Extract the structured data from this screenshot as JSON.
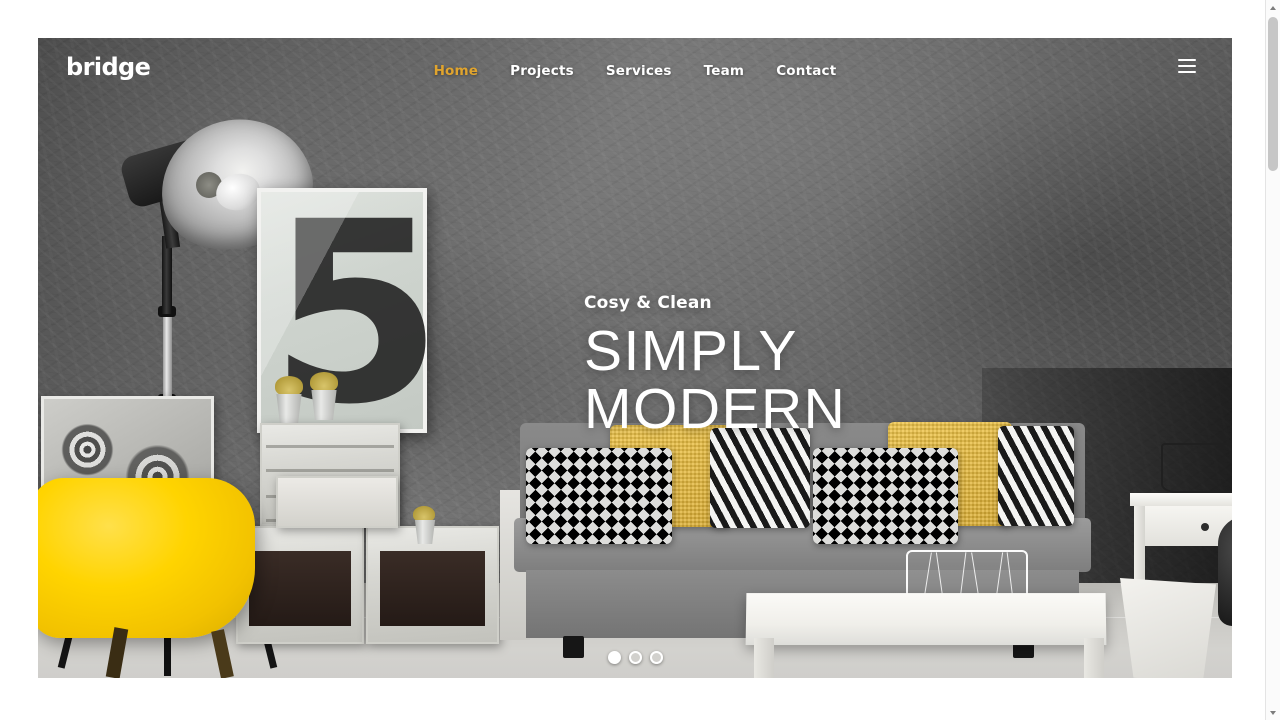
{
  "site": {
    "logo": "bridge",
    "accent_color": "#e0a42e",
    "wall_color": "#6d6d6d",
    "chair_color": "#ffd400"
  },
  "nav": {
    "items": [
      {
        "label": "Home",
        "active": true
      },
      {
        "label": "Projects",
        "active": false
      },
      {
        "label": "Services",
        "active": false
      },
      {
        "label": "Team",
        "active": false
      },
      {
        "label": "Contact",
        "active": false
      }
    ],
    "menu_icon": "hamburger-icon"
  },
  "hero": {
    "subtitle": "Cosy & Clean",
    "title_line1": "SIMPLY",
    "title_line2": "MODERN",
    "poster_text": "5",
    "slides": [
      {
        "index": 1,
        "active": true
      },
      {
        "index": 2,
        "active": false
      },
      {
        "index": 3,
        "active": false
      }
    ]
  },
  "scrollbar": {
    "up_arrow": "scroll-up-icon",
    "down_arrow": "scroll-down-icon"
  }
}
